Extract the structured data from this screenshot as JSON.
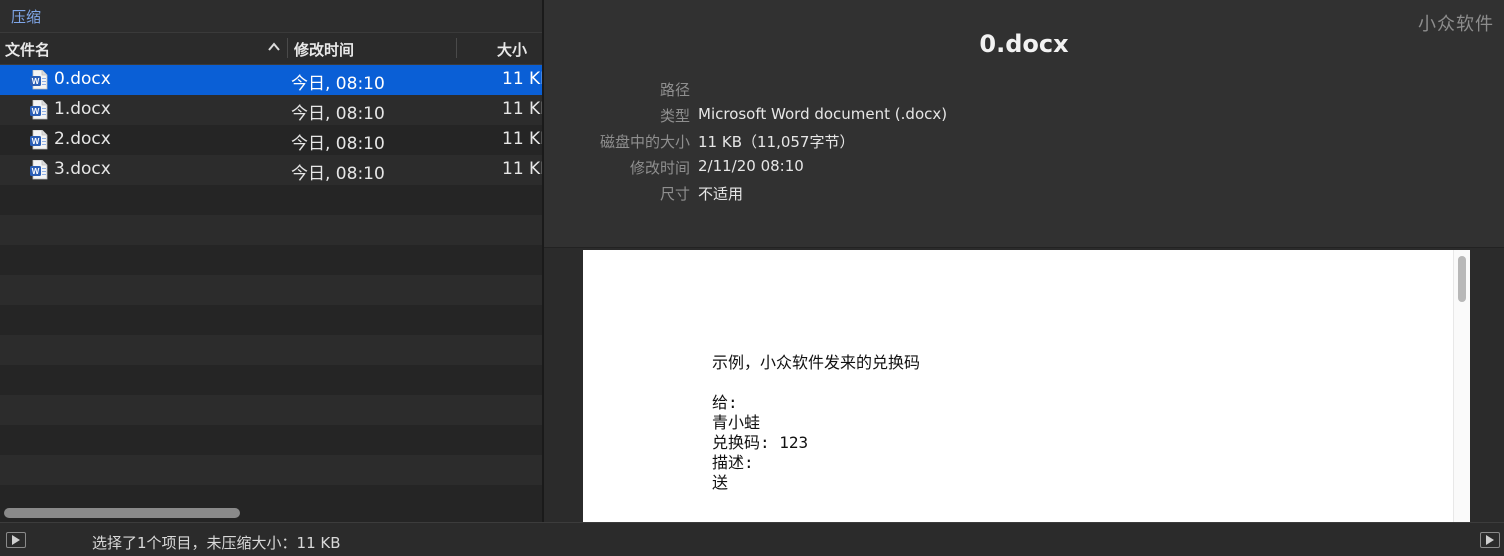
{
  "breadcrumb": "压缩",
  "columns": {
    "name": "文件名",
    "modified": "修改时间",
    "size": "大小"
  },
  "files": [
    {
      "name": "0.docx",
      "modified": "今日, 08:10",
      "size": "11 KB",
      "selected": true,
      "icon": "word-doc-icon"
    },
    {
      "name": "1.docx",
      "modified": "今日, 08:10",
      "size": "11 KB",
      "selected": false,
      "icon": "word-doc-icon"
    },
    {
      "name": "2.docx",
      "modified": "今日, 08:10",
      "size": "11 KB",
      "selected": false,
      "icon": "word-doc-icon"
    },
    {
      "name": "3.docx",
      "modified": "今日, 08:10",
      "size": "11 KB",
      "selected": false,
      "icon": "word-doc-icon"
    }
  ],
  "watermark": "小众软件",
  "info": {
    "title": "0.docx",
    "rows": [
      {
        "label": "路径",
        "value": ""
      },
      {
        "label": "类型",
        "value": "Microsoft Word document (.docx)"
      },
      {
        "label": "磁盘中的大小",
        "value": "11 KB（11,057字节）"
      },
      {
        "label": "修改时间",
        "value": "2/11/20 08:10"
      },
      {
        "label": "尺寸",
        "value": "不适用"
      }
    ]
  },
  "preview": {
    "lines": [
      "示例，小众软件发来的兑换码",
      "",
      "给:",
      "青小蛙",
      "兑换码: 123",
      "描述:",
      "送"
    ]
  },
  "status": {
    "text": "选择了1个项目，未压缩大小：11 KB"
  },
  "colors": {
    "selection": "#0a5fd6",
    "breadcrumb": "#7fa6e8",
    "word_icon": "#2b5eb5"
  }
}
